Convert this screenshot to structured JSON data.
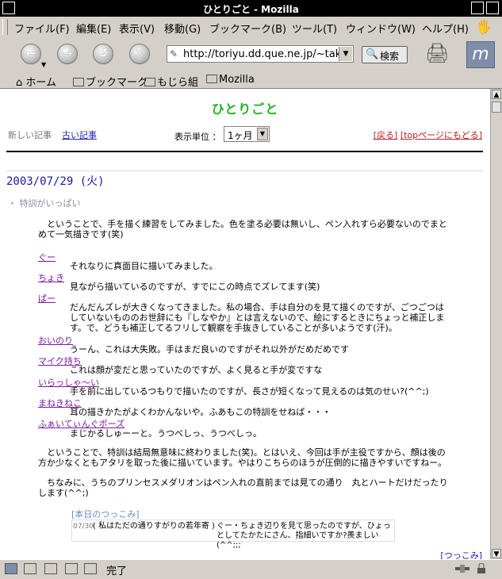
{
  "window": {
    "title": "ひとりごと - Mozilla"
  },
  "menu": [
    "ファイル(F)",
    "編集(E)",
    "表示(V)",
    "移動(G)",
    "ブックマーク(B)",
    "ツール(T)",
    "ウィンドウ(W)",
    "ヘルプ(H)"
  ],
  "toolbar": {
    "url": "http://toriyu.dd.que.ne.jp/~takat",
    "search_label": "検索"
  },
  "personal_bar": [
    "ホーム",
    "ブックマーク",
    "もじら組",
    "Mozilla"
  ],
  "page": {
    "title": "ひとりごと",
    "nav_new": "新しい記事",
    "nav_old": "古い記事",
    "unit_label": "表示単位 ：",
    "unit_value": "1ヶ月",
    "link_back": "[戻る]",
    "link_top": "[topページにもどる]",
    "date": "2003/07/29 (火)",
    "subject": "・ 特訓がいっぱい",
    "intro": "　ということで、手を描く練習をしてみました。色を塗る必要は無いし、ペン入れすら必要ないのでまとめて一気描きです(笑)",
    "entries": [
      {
        "name": "ぐー",
        "text": "それなりに真面目に描いてみました。"
      },
      {
        "name": "ちょき",
        "text": "見ながら描いているのですが、すでにこの時点でズレてます(笑)"
      },
      {
        "name": "ぱー",
        "text": "だんだんズレが大きくなってきました。私の場合、手は自分のを見て描くのですが、ごつごつはしていないもののお世辞にも『しなやか』とは言えないので、絵にするときにちょっと補正します。で、どうも補正してるフリして観察を手抜きしていることが多いようです(汗)。"
      },
      {
        "name": "おいのり",
        "text": "うーん、これは大失敗。手はまだ良いのですがそれ以外がだめだめです"
      },
      {
        "name": "マイク持ち",
        "text": "これは顔が変だと思っていたのですが、よく見ると手が変ですな"
      },
      {
        "name": "いらっしゃ〜い",
        "text": "手を前に出しているつもりで描いたのですが、長さが短くなって見えるのは気のせい?(^^;)"
      },
      {
        "name": "まねきねこ",
        "text": "耳の描きかたがよくわかんないや。ふあもこの特訓をせねば・・・"
      },
      {
        "name": "ふぁいてぃんぐポーズ",
        "text": "まじかるしゅーーと。うつべしっ、うつべしっ。"
      }
    ],
    "outro1": "　ということで、特訓は結局無意味に終わりました(笑)。とはいえ、今回は手が主役ですから、顔は後の方か少なくともアタリを取った後に描いています。やはりこちらのほうが圧倒的に描きやすいですねー。",
    "outro2": "　ちなみに、うちのプリンセスメダリオンはペン入れの直前までは見ての通り　丸とハートだけだったりします(^^;)",
    "tsukkomi_head": "[本日のつっこみ]",
    "tsukkomi_date": "07/30",
    "tsukkomi_who": "( 私はただの通りすがりの若年寄 )",
    "tsukkomi_msg": "ぐー・ちょき辺りを見て思ったのですが、ひょっとしてたかたにさん、指細いですか?羨ましい(^^;;;",
    "tsukkomi_link": "[つっこみ]"
  },
  "status": {
    "text": "完了"
  }
}
